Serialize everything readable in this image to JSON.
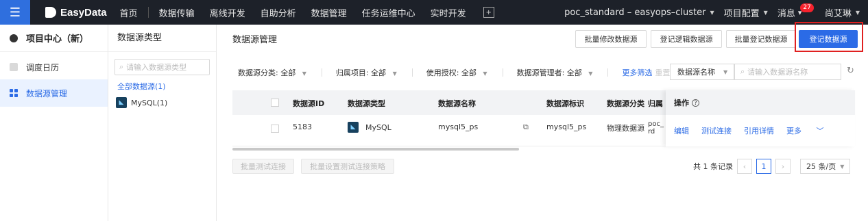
{
  "topbar": {
    "brand": "EasyData",
    "nav": [
      "首页",
      "数据传输",
      "离线开发",
      "自助分析",
      "数据管理",
      "任务运维中心",
      "实时开发"
    ],
    "cluster": "poc_standard – easyops–cluster",
    "project_config": "项目配置",
    "messages": "消息",
    "message_count": "27",
    "user": "尚艾琳"
  },
  "sidebar": {
    "title": "项目中心（新）",
    "items": [
      {
        "label": "调度日历"
      },
      {
        "label": "数据源管理"
      }
    ]
  },
  "type_panel": {
    "title": "数据源类型",
    "search_placeholder": "请输入数据源类型",
    "all_label": "全部数据源(1)",
    "types": [
      {
        "label": "MySQL(1)"
      }
    ]
  },
  "main": {
    "title": "数据源管理",
    "buttons": {
      "batch_edit": "批量修改数据源",
      "register_logic": "登记逻辑数据源",
      "batch_register": "批量登记数据源",
      "register": "登记数据源"
    },
    "filters": {
      "category": "数据源分类: 全部",
      "project": "归属项目: 全部",
      "auth": "使用授权: 全部",
      "manager": "数据源管理者: 全部",
      "more": "更多筛选",
      "reset": "重置",
      "field_select": "数据源名称",
      "search_placeholder": "请输入数据源名称"
    },
    "table": {
      "columns": [
        "数据源ID",
        "数据源类型",
        "数据源名称",
        "数据源标识",
        "数据源分类",
        "归属"
      ],
      "ops_header": "操作",
      "rows": [
        {
          "id": "5183",
          "type": "MySQL",
          "name": "mysql5_ps",
          "identifier": "mysql5_ps",
          "category": "物理数据源",
          "owner": "poc_\nrd"
        }
      ],
      "ops": [
        "编辑",
        "测试连接",
        "引用详情",
        "更多"
      ]
    },
    "footer": {
      "batch_test": "批量测试连接",
      "batch_policy": "批量设置测试连接策略",
      "total": "共 1 条记录",
      "page": "1",
      "page_size": "25 条/页"
    }
  }
}
